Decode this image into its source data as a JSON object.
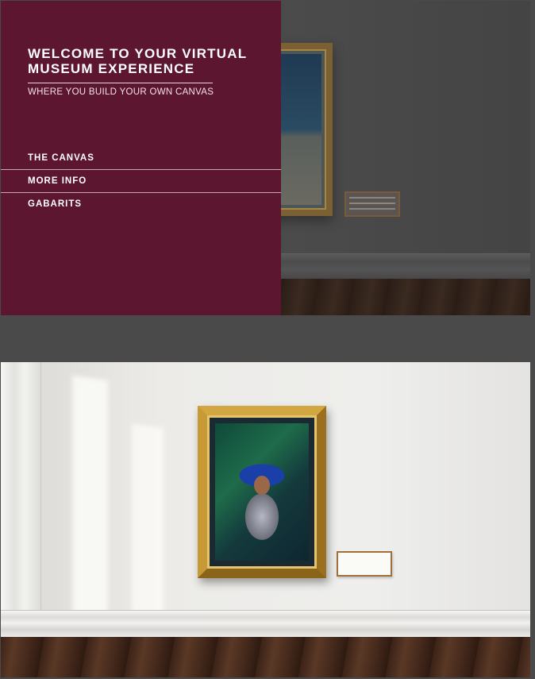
{
  "hero": {
    "title_line1": "WELCOME TO YOUR VIRTUAL",
    "title_line2": "MUSEUM EXPERIENCE",
    "subtitle": "WHERE YOU BUILD YOUR OWN CANVAS"
  },
  "menu": {
    "items": [
      {
        "label": "THE CANVAS"
      },
      {
        "label": "MORE INFO"
      },
      {
        "label": "GABARITS"
      }
    ]
  },
  "colors": {
    "overlay": "#5c1630",
    "text": "#ffffff",
    "frame_gold": "#b98c2a"
  }
}
